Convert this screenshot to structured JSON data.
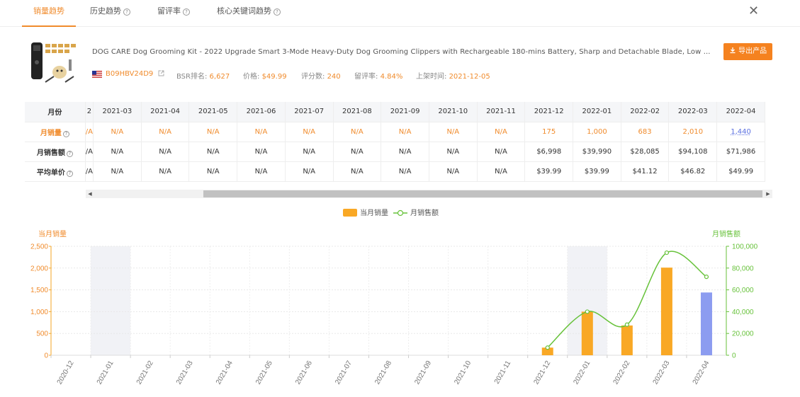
{
  "tabs": [
    {
      "label": "销量趋势",
      "active": true
    },
    {
      "label": "历史趋势",
      "help": true
    },
    {
      "label": "留评率",
      "help": true
    },
    {
      "label": "核心关键词趋势",
      "help": true
    }
  ],
  "close_symbol": "✕",
  "product": {
    "title": "DOG CARE Dog Grooming Kit - 2022 Upgrade Smart 3-Mode Heavy-Duty Dog Grooming Clippers with Rechargeable 180-mins Battery, Sharp and Detachable Blade, Low ...",
    "asin": "B09HBV24D9",
    "bsr_label": "BSR排名:",
    "bsr": "6,627",
    "price_label": "价格:",
    "price": "$49.99",
    "reviews_label": "评分数:",
    "reviews": "240",
    "review_rate_label": "留评率:",
    "review_rate": "4.84%",
    "launch_label": "上架时间:",
    "launch": "2021-12-05",
    "export_label": "导出产品"
  },
  "table": {
    "header_label": "月份",
    "cut_header": "2",
    "months": [
      "2021-03",
      "2021-04",
      "2021-05",
      "2021-06",
      "2021-07",
      "2021-08",
      "2021-09",
      "2021-10",
      "2021-11",
      "2021-12",
      "2022-01",
      "2022-02",
      "2022-03",
      "2022-04"
    ],
    "rows": [
      {
        "label": "月销量",
        "help": true,
        "cut": "/A",
        "values": [
          "N/A",
          "N/A",
          "N/A",
          "N/A",
          "N/A",
          "N/A",
          "N/A",
          "N/A",
          "N/A",
          "175",
          "1,000",
          "683",
          "2,010",
          "1,440"
        ]
      },
      {
        "label": "月销售额",
        "help": true,
        "cut": "/A",
        "values": [
          "N/A",
          "N/A",
          "N/A",
          "N/A",
          "N/A",
          "N/A",
          "N/A",
          "N/A",
          "N/A",
          "$6,998",
          "$39,990",
          "$28,085",
          "$94,108",
          "$71,986"
        ]
      },
      {
        "label": "平均单价",
        "help": true,
        "cut": "/A",
        "values": [
          "N/A",
          "N/A",
          "N/A",
          "N/A",
          "N/A",
          "N/A",
          "N/A",
          "N/A",
          "N/A",
          "$39.99",
          "$39.99",
          "$41.12",
          "$46.82",
          "$49.99"
        ]
      }
    ]
  },
  "colors": {
    "accent": "#f08b2c",
    "bar": "#f9a825",
    "bar_last": "#8c9cf0",
    "line": "#67c23a"
  },
  "chart_data": {
    "type": "bar",
    "legend": [
      "当月销量",
      "月销售额"
    ],
    "left_axis_label": "当月销量",
    "right_axis_label": "月销售额",
    "categories": [
      "2020-12",
      "2021-01",
      "2021-02",
      "2021-03",
      "2021-04",
      "2021-05",
      "2021-06",
      "2021-07",
      "2021-08",
      "2021-09",
      "2021-10",
      "2021-11",
      "2021-12",
      "2022-01",
      "2022-02",
      "2022-03",
      "2022-04"
    ],
    "series": [
      {
        "name": "当月销量",
        "type": "bar",
        "axis": "left",
        "values": [
          0,
          0,
          0,
          0,
          0,
          0,
          0,
          0,
          0,
          0,
          0,
          0,
          175,
          1000,
          683,
          2010,
          1440
        ]
      },
      {
        "name": "月销售额",
        "type": "line",
        "axis": "right",
        "values": [
          null,
          null,
          null,
          null,
          null,
          null,
          null,
          null,
          null,
          null,
          null,
          null,
          6998,
          39990,
          28085,
          94108,
          71986
        ]
      }
    ],
    "y_left_ticks": [
      "0",
      "500",
      "1,000",
      "1,500",
      "2,000",
      "2,500"
    ],
    "y_left_range": [
      0,
      2500
    ],
    "y_right_ticks": [
      "0",
      "20,000",
      "40,000",
      "60,000",
      "80,000",
      "100,000"
    ],
    "y_right_range": [
      0,
      100000
    ],
    "shaded_categories": [
      "2021-01",
      "2022-01"
    ]
  }
}
